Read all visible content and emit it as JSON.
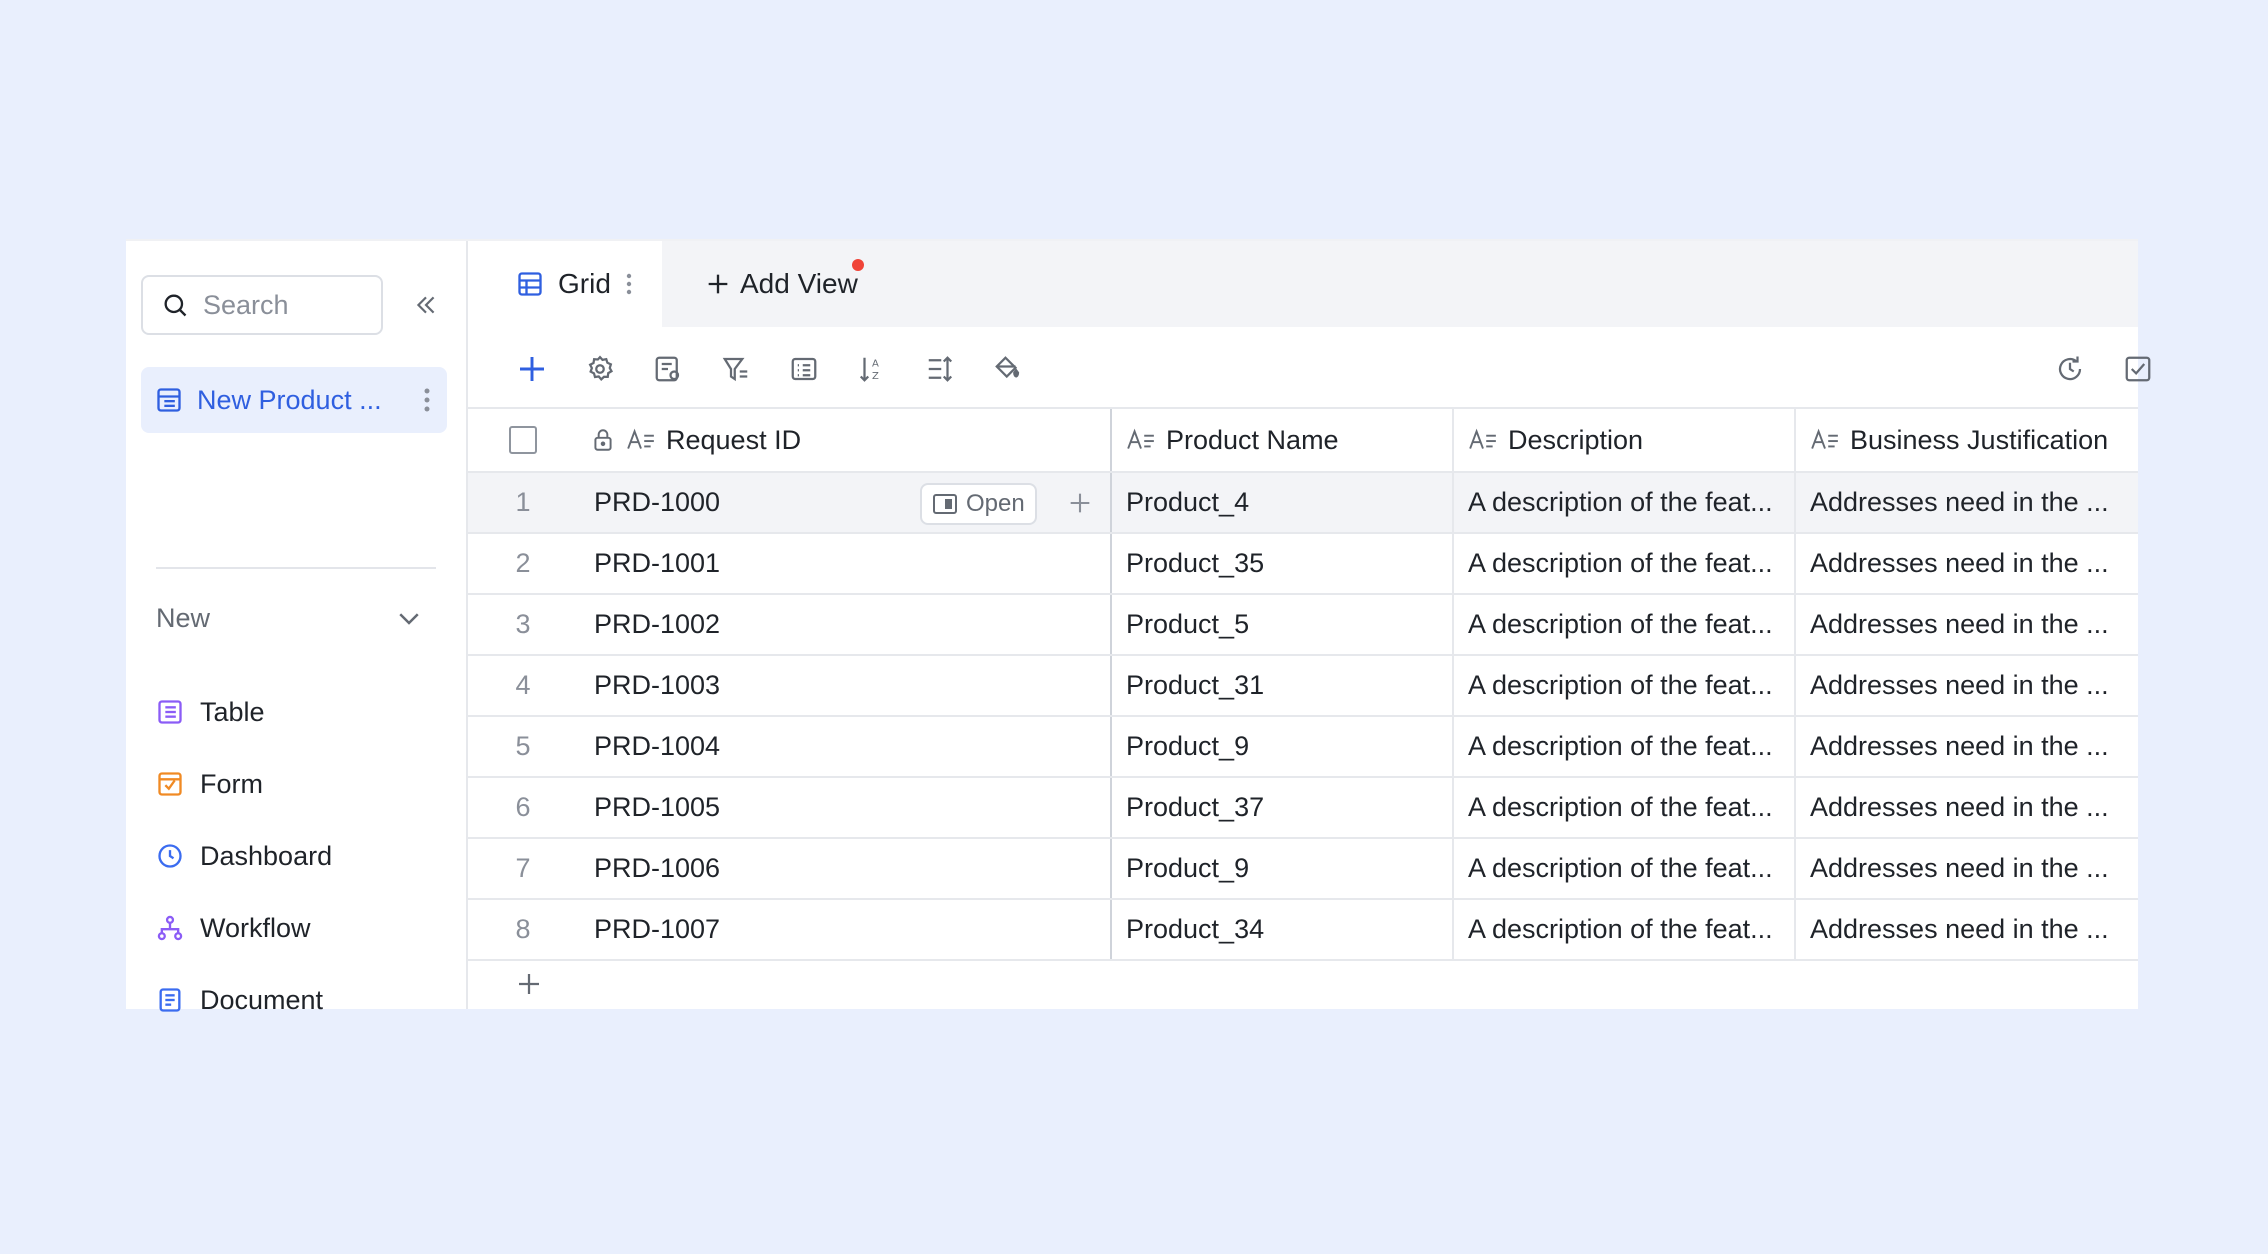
{
  "sidebar": {
    "search_placeholder": "Search",
    "base_item_label": "New Product ...",
    "new_label": "New",
    "create_items": [
      {
        "label": "Table",
        "icon": "table-icon"
      },
      {
        "label": "Form",
        "icon": "form-icon"
      },
      {
        "label": "Dashboard",
        "icon": "dashboard-icon"
      },
      {
        "label": "Workflow",
        "icon": "workflow-icon"
      },
      {
        "label": "Document",
        "icon": "document-icon"
      }
    ]
  },
  "tabs": {
    "grid_label": "Grid",
    "add_view_label": "Add View"
  },
  "grid": {
    "columns": [
      "Request ID",
      "Product Name",
      "Description",
      "Business Justification"
    ],
    "hover_open_label": "Open",
    "rows": [
      {
        "num": "1",
        "id": "PRD-1000",
        "name": "Product_4",
        "desc": "A description of the feat...",
        "just": "Addresses need in the ..."
      },
      {
        "num": "2",
        "id": "PRD-1001",
        "name": "Product_35",
        "desc": "A description of the feat...",
        "just": "Addresses need in the ..."
      },
      {
        "num": "3",
        "id": "PRD-1002",
        "name": "Product_5",
        "desc": "A description of the feat...",
        "just": "Addresses need in the ..."
      },
      {
        "num": "4",
        "id": "PRD-1003",
        "name": "Product_31",
        "desc": "A description of the feat...",
        "just": "Addresses need in the ..."
      },
      {
        "num": "5",
        "id": "PRD-1004",
        "name": "Product_9",
        "desc": "A description of the feat...",
        "just": "Addresses need in the ..."
      },
      {
        "num": "6",
        "id": "PRD-1005",
        "name": "Product_37",
        "desc": "A description of the feat...",
        "just": "Addresses need in the ..."
      },
      {
        "num": "7",
        "id": "PRD-1006",
        "name": "Product_9",
        "desc": "A description of the feat...",
        "just": "Addresses need in the ..."
      },
      {
        "num": "8",
        "id": "PRD-1007",
        "name": "Product_34",
        "desc": "A description of the feat...",
        "just": "Addresses need in the ..."
      }
    ]
  },
  "colors": {
    "accent": "#2f5fe0",
    "background": "#e9effd",
    "notification_dot": "#f04438"
  }
}
